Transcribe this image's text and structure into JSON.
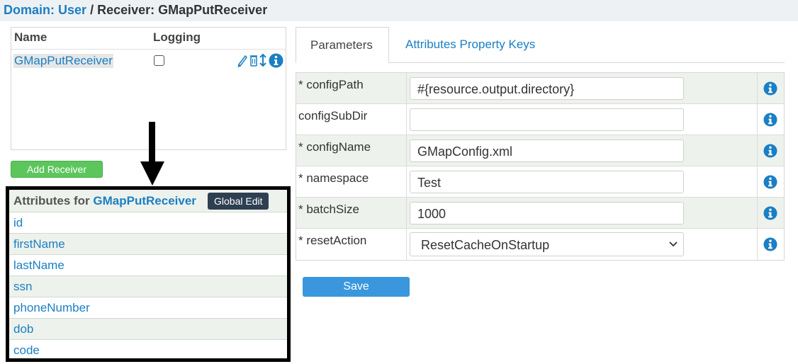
{
  "breadcrumb": {
    "domain_label": "Domain:",
    "domain_value": "User",
    "separator": "/",
    "receiver_text": "Receiver: GMapPutReceiver"
  },
  "receivers": {
    "headers": {
      "name": "Name",
      "logging": "Logging"
    },
    "rows": [
      {
        "name": "GMapPutReceiver",
        "logging": false,
        "icons": [
          "pencil-icon",
          "trash-icon",
          "up-down-arrow-icon",
          "info-icon"
        ]
      }
    ],
    "add_button": "Add Receiver"
  },
  "attributes": {
    "title_prefix": "Attributes for",
    "receiver_name": "GMapPutReceiver",
    "global_edit": "Global Edit",
    "items": [
      "id",
      "firstName",
      "lastName",
      "ssn",
      "phoneNumber",
      "dob",
      "code"
    ]
  },
  "tabs": [
    {
      "label": "Parameters",
      "active": true
    },
    {
      "label": "Attributes Property Keys",
      "active": false
    }
  ],
  "parameters": [
    {
      "label": "* configPath",
      "value": "#{resource.output.directory}",
      "type": "text"
    },
    {
      "label": "configSubDir",
      "value": "",
      "type": "text"
    },
    {
      "label": "* configName",
      "value": "GMapConfig.xml",
      "type": "text"
    },
    {
      "label": "* namespace",
      "value": "Test",
      "type": "text"
    },
    {
      "label": "* batchSize",
      "value": "1000",
      "type": "text"
    },
    {
      "label": "* resetAction",
      "value": "ResetCacheOnStartup",
      "type": "select"
    }
  ],
  "save_button": "Save",
  "colors": {
    "link": "#1a7fc4",
    "add_button": "#5cc65c",
    "save_button": "#3a97dd",
    "global_edit": "#2e3f52",
    "info_icon": "#1a7fc4"
  }
}
